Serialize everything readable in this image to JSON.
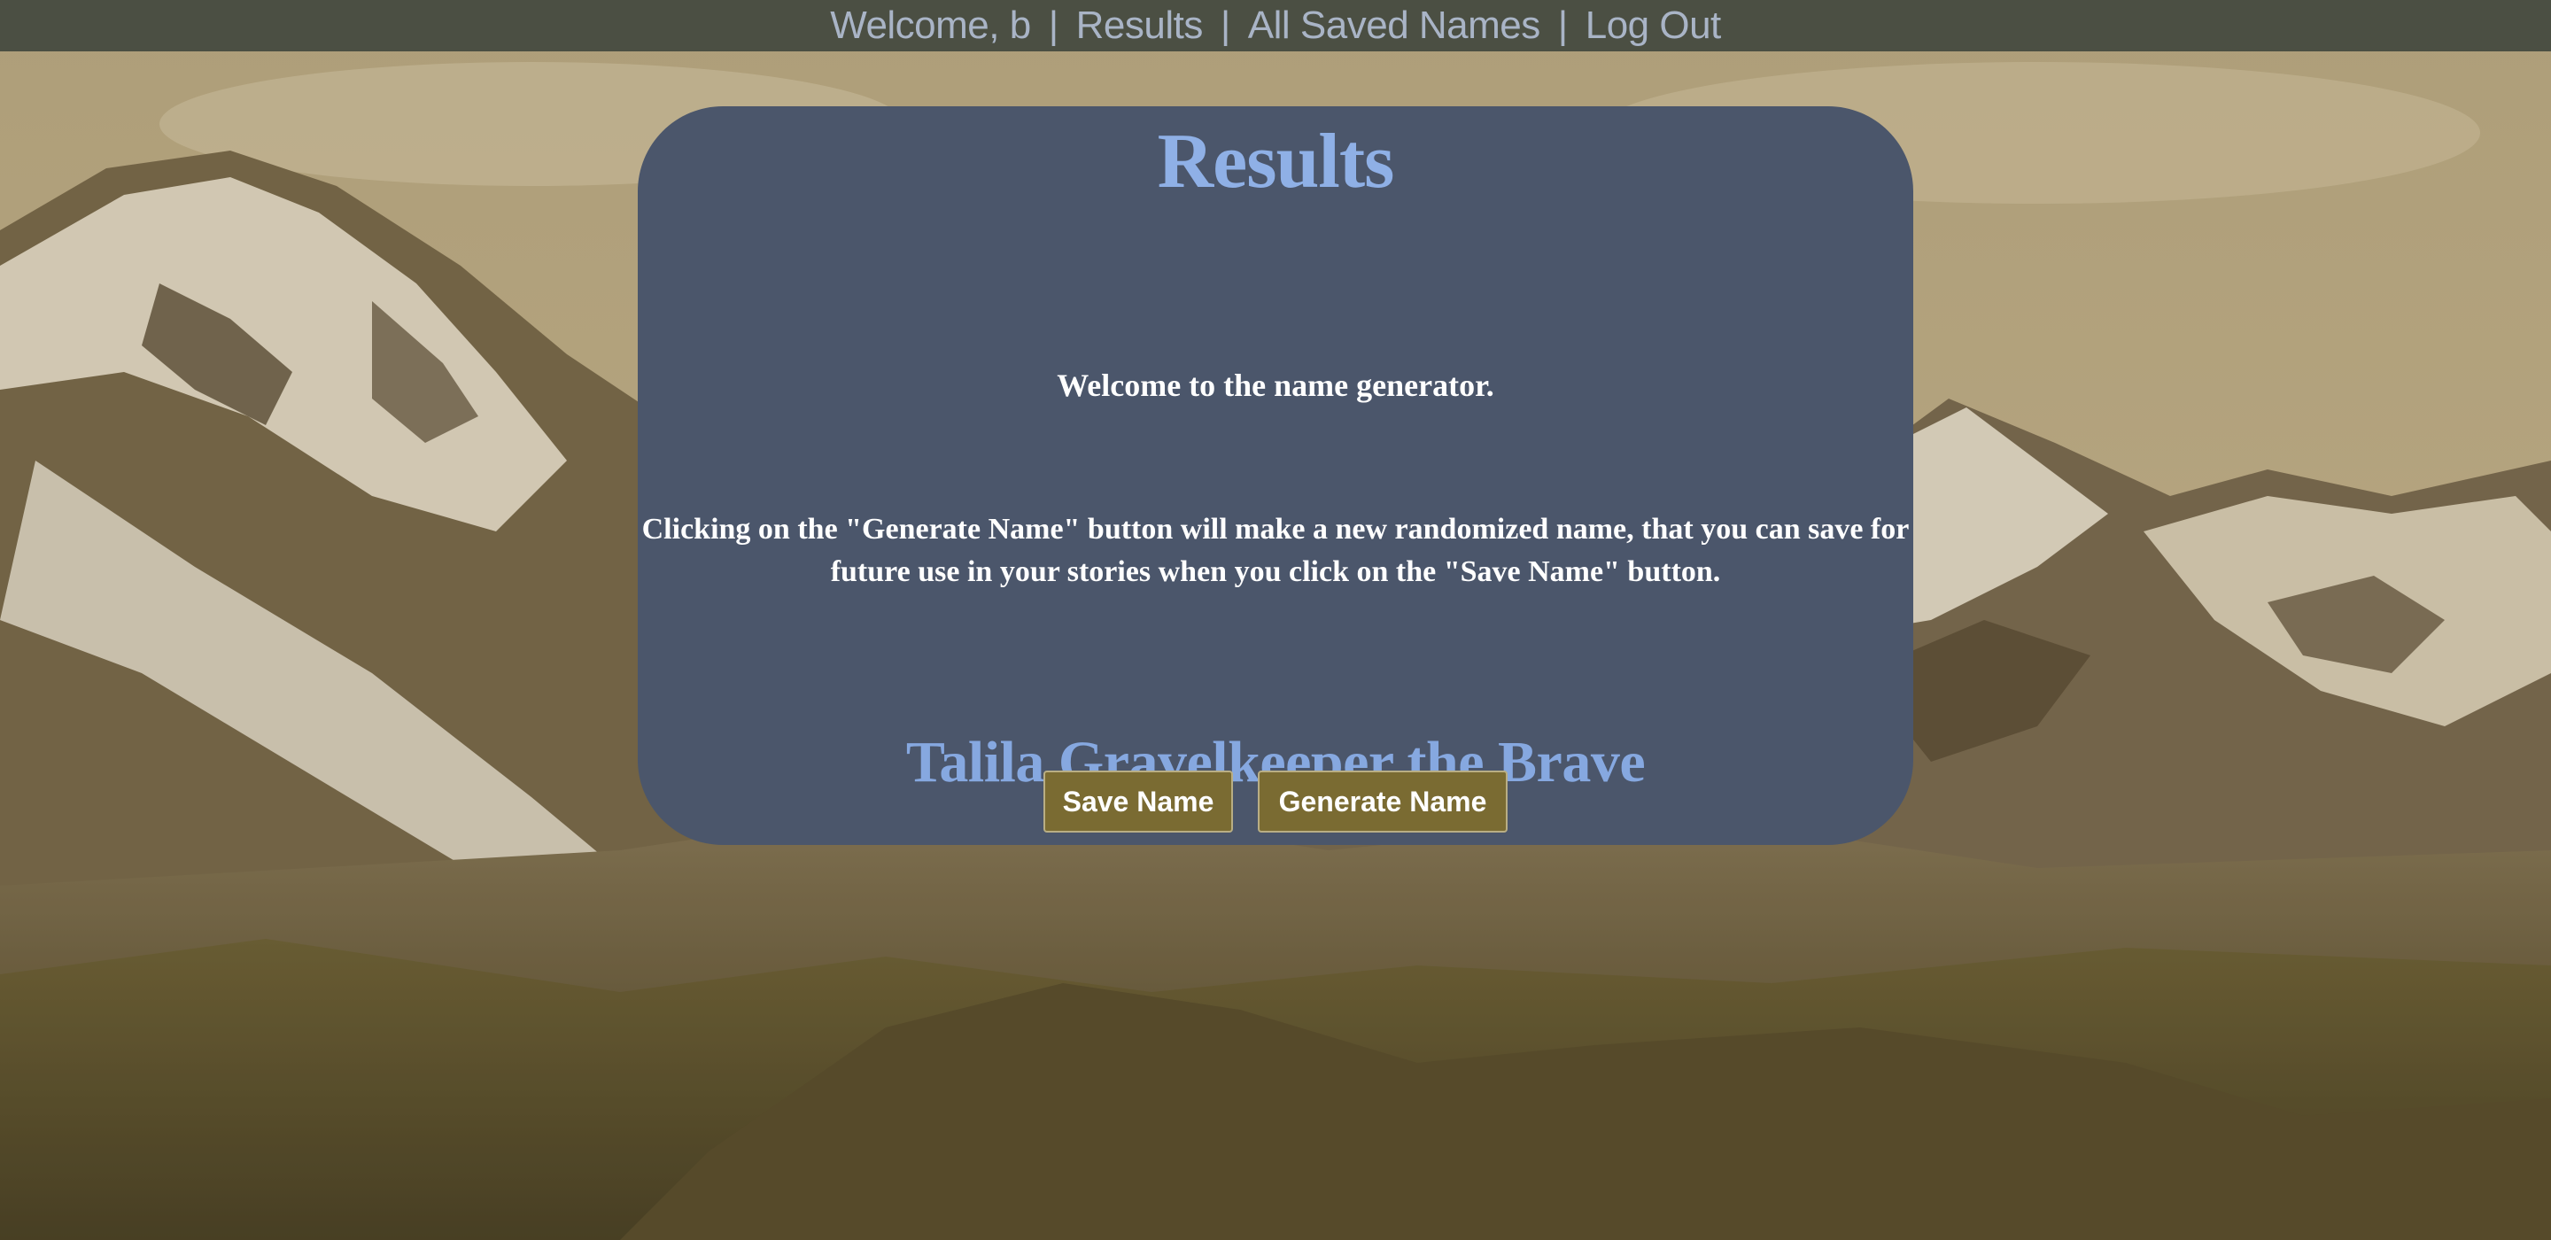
{
  "nav": {
    "welcome": "Welcome, b",
    "separator": "|",
    "results": "Results",
    "all_saved": "All Saved Names",
    "logout": "Log Out"
  },
  "card": {
    "title": "Results",
    "intro": "Welcome to the name generator.",
    "description": "Clicking on the \"Generate Name\" button will make a new randomized name, that you can save for future use in your stories when you click on the \"Save Name\" button.",
    "generated_name": "Talila Gravelkeeper the Brave"
  },
  "buttons": {
    "save": "Save Name",
    "generate": "Generate Name"
  },
  "colors": {
    "nav_bg": "#4b4f43",
    "nav_text": "#a9b4c6",
    "card_bg": "#4b566b",
    "accent_blue": "#8fb0e6",
    "button_bg": "#7a6b32"
  }
}
